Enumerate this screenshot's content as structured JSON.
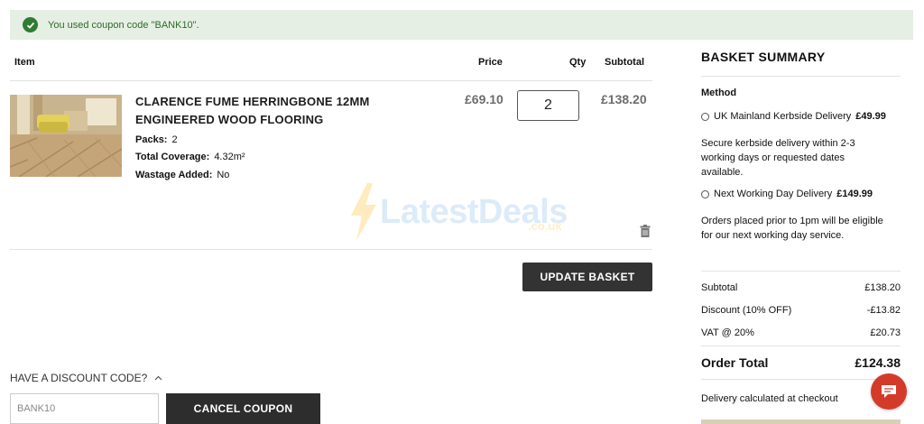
{
  "notice": {
    "message": "You used coupon code \"BANK10\"."
  },
  "table": {
    "headers": {
      "item": "Item",
      "price": "Price",
      "qty": "Qty",
      "subtotal": "Subtotal"
    }
  },
  "product": {
    "title": "CLARENCE FUME HERRINGBONE 12MM ENGINEERED WOOD FLOORING",
    "packs_label": "Packs:",
    "packs_value": "2",
    "coverage_label": "Total Coverage:",
    "coverage_value": "4.32m²",
    "wastage_label": "Wastage Added:",
    "wastage_value": "No",
    "price": "£69.10",
    "qty": "2",
    "subtotal": "£138.20"
  },
  "actions": {
    "update_basket": "UPDATE BASKET"
  },
  "watermark": {
    "text": "LatestDeals",
    "sub": ".co.uk"
  },
  "discount": {
    "toggle_label": "HAVE A DISCOUNT CODE?",
    "code_value": "BANK10",
    "cancel_label": "CANCEL COUPON"
  },
  "summary": {
    "title": "BASKET SUMMARY",
    "method_label": "Method",
    "options": [
      {
        "label": "UK Mainland Kerbside Delivery",
        "price": "£49.99",
        "description": "Secure kerbside delivery within 2-3 working days or requested dates available."
      },
      {
        "label": "Next Working Day Delivery",
        "price": "£149.99",
        "description": "Orders placed prior to 1pm will be eligible for our next working day service."
      }
    ],
    "rows": [
      {
        "label": "Subtotal",
        "value": "£138.20"
      },
      {
        "label": "Discount (10% OFF)",
        "value": "-£13.82"
      },
      {
        "label": "VAT @ 20%",
        "value": "£20.73"
      }
    ],
    "total_label": "Order Total",
    "total_value": "£124.38",
    "delivery_note": "Delivery calculated at checkout"
  },
  "colors": {
    "accent_dark": "#333333",
    "notice_bg": "#e6efe4",
    "success": "#2f7d32",
    "chat": "#d43a2a"
  }
}
